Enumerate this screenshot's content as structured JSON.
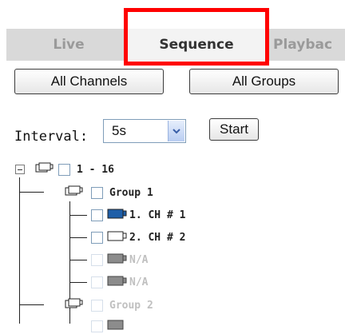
{
  "tabs": [
    {
      "label": "Live"
    },
    {
      "label": "Sequence"
    },
    {
      "label": "Playbac"
    }
  ],
  "buttons": {
    "all_channels": "All Channels",
    "all_groups": "All Groups",
    "start": "Start"
  },
  "interval": {
    "label": "Interval:",
    "selected": "5s"
  },
  "tree": {
    "root": {
      "label": "1 - 16"
    },
    "groups": [
      {
        "label": "Group 1",
        "channels": [
          {
            "label": "1. CH # 1",
            "status": "active"
          },
          {
            "label": "2. CH # 2",
            "status": "available"
          },
          {
            "label": "N/A",
            "status": "unavailable"
          },
          {
            "label": "N/A",
            "status": "unavailable"
          }
        ]
      },
      {
        "label": "Group 2",
        "channels": []
      }
    ]
  },
  "colors": {
    "highlight": "#ff0000",
    "active_camera": "#1f5fa8",
    "inactive_camera": "#8c8c8c"
  }
}
